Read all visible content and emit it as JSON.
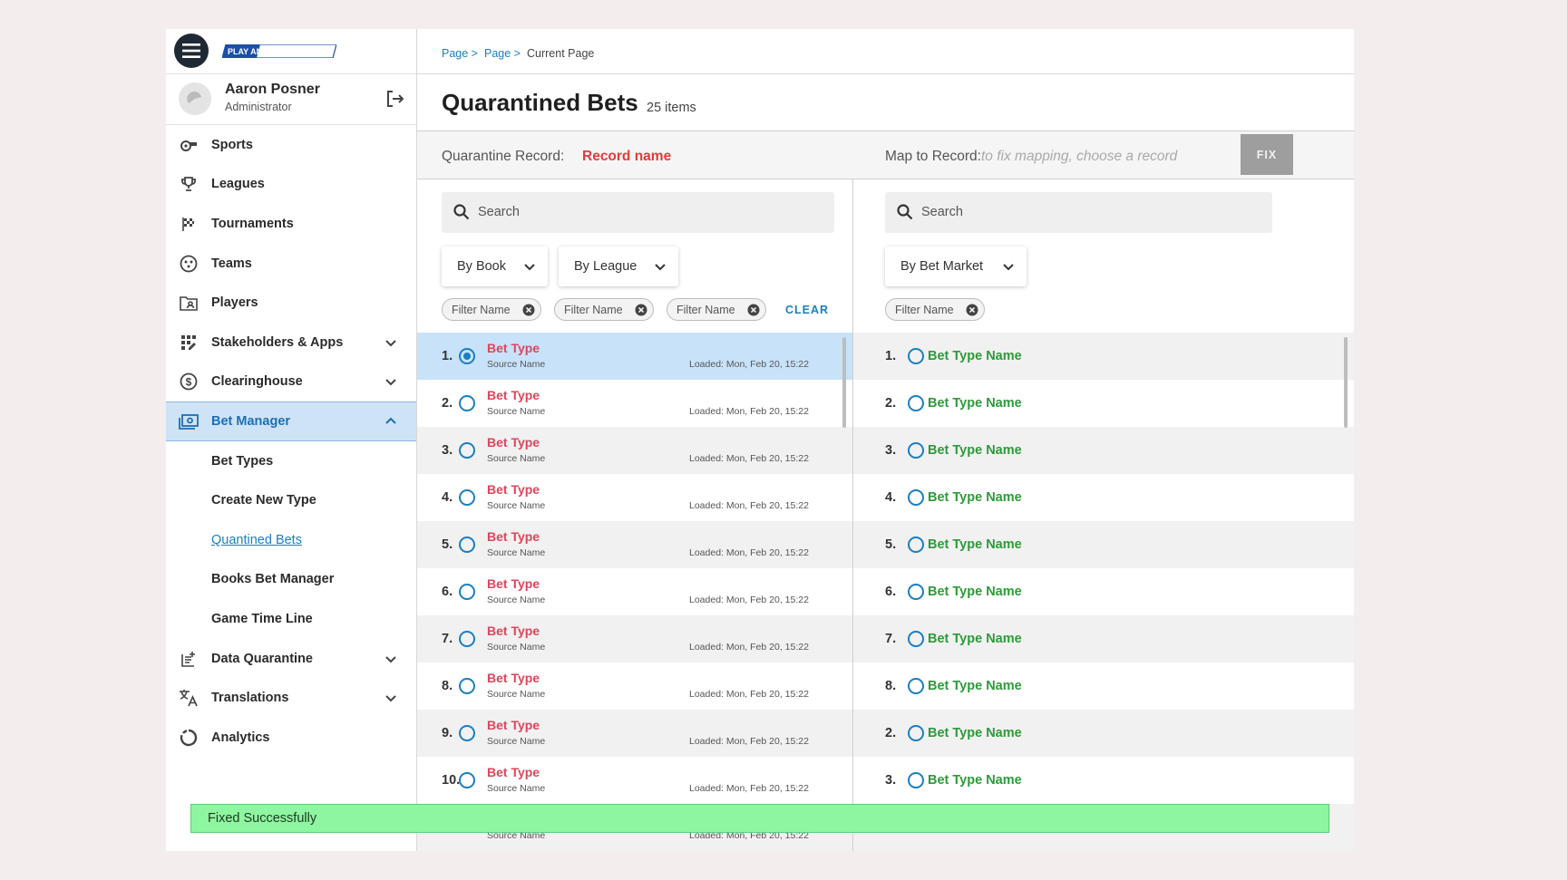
{
  "brand": {
    "logo_text": "PLAY ANYWHERE"
  },
  "user": {
    "name": "Aaron Posner",
    "role": "Administrator"
  },
  "sidebar": {
    "items": [
      {
        "label": "Sports",
        "icon": "whistle-icon"
      },
      {
        "label": "Leagues",
        "icon": "trophy-icon"
      },
      {
        "label": "Tournaments",
        "icon": "flag-icon"
      },
      {
        "label": "Teams",
        "icon": "teams-icon"
      },
      {
        "label": "Players",
        "icon": "folder-user-icon"
      },
      {
        "label": "Stakeholders & Apps",
        "icon": "apps-icon"
      },
      {
        "label": "Clearinghouse",
        "icon": "dollar-icon"
      },
      {
        "label": "Bet Manager",
        "icon": "bet-manager-icon"
      }
    ],
    "sub_items": [
      "Bet Types",
      "Create New Type",
      "Quantined Bets",
      "Books Bet Manager",
      "Game Time Line"
    ],
    "bottom_items": [
      {
        "label": "Data Quarantine",
        "icon": "data-quarantine-icon"
      },
      {
        "label": "Translations",
        "icon": "translate-icon"
      },
      {
        "label": "Analytics",
        "icon": "analytics-icon"
      }
    ]
  },
  "breadcrumb": {
    "items": [
      "Page >",
      "Page >"
    ],
    "current": "Current Page"
  },
  "page": {
    "title": "Quarantined Bets",
    "count": "25 items"
  },
  "record_bar": {
    "quarantine_label": "Quarantine Record:",
    "quarantine_value": "Record name",
    "map_label": "Map to Record:",
    "map_placeholder": "to fix mapping, choose a record",
    "fix_label": "FIX"
  },
  "left_panel": {
    "search_placeholder": "Search",
    "dropdowns": [
      "By Book",
      "By League"
    ],
    "chips": [
      "Filter Name",
      "Filter Name",
      "Filter Name"
    ],
    "clear_label": "CLEAR",
    "rows": [
      {
        "num": "1.",
        "type": "Bet Type",
        "source": "Source Name",
        "loaded": "Loaded: Mon, Feb 20, 15:22",
        "selected": true
      },
      {
        "num": "2.",
        "type": "Bet Type",
        "source": "Source Name",
        "loaded": "Loaded: Mon, Feb 20, 15:22"
      },
      {
        "num": "3.",
        "type": "Bet Type",
        "source": "Source Name",
        "loaded": "Loaded: Mon, Feb 20, 15:22"
      },
      {
        "num": "4.",
        "type": "Bet Type",
        "source": "Source Name",
        "loaded": "Loaded: Mon, Feb 20, 15:22"
      },
      {
        "num": "5.",
        "type": "Bet Type",
        "source": "Source Name",
        "loaded": "Loaded: Mon, Feb 20, 15:22"
      },
      {
        "num": "6.",
        "type": "Bet Type",
        "source": "Source Name",
        "loaded": "Loaded: Mon, Feb 20, 15:22"
      },
      {
        "num": "7.",
        "type": "Bet Type",
        "source": "Source Name",
        "loaded": "Loaded: Mon, Feb 20, 15:22"
      },
      {
        "num": "8.",
        "type": "Bet Type",
        "source": "Source Name",
        "loaded": "Loaded: Mon, Feb 20, 15:22"
      },
      {
        "num": "9.",
        "type": "Bet Type",
        "source": "Source Name",
        "loaded": "Loaded: Mon, Feb 20, 15:22"
      },
      {
        "num": "10.",
        "type": "Bet Type",
        "source": "Source Name",
        "loaded": "Loaded: Mon, Feb 20, 15:22"
      },
      {
        "num": "",
        "type": "",
        "source": "Source Name",
        "loaded": "Loaded: Mon, Feb 20, 15:22"
      }
    ]
  },
  "right_panel": {
    "search_placeholder": "Search",
    "dropdowns": [
      "By Bet Market"
    ],
    "chips": [
      "Filter Name"
    ],
    "rows": [
      {
        "num": "1.",
        "name": "Bet Type Name"
      },
      {
        "num": "2.",
        "name": "Bet Type Name"
      },
      {
        "num": "3.",
        "name": "Bet Type Name"
      },
      {
        "num": "4.",
        "name": "Bet Type Name"
      },
      {
        "num": "5.",
        "name": "Bet Type Name"
      },
      {
        "num": "6.",
        "name": "Bet Type Name"
      },
      {
        "num": "7.",
        "name": "Bet Type Name"
      },
      {
        "num": "8.",
        "name": "Bet Type Name"
      },
      {
        "num": "2.",
        "name": "Bet Type Name"
      },
      {
        "num": "3.",
        "name": "Bet Type Name"
      },
      {
        "num": "",
        "name": ""
      }
    ]
  },
  "toast": {
    "message": "Fixed Successfully"
  },
  "colors": {
    "accent": "#1a7fc1",
    "error": "#e0455a",
    "success": "#2e9a3a",
    "toast_bg": "#8ef5a0",
    "selected_row": "#c8e2fa"
  }
}
